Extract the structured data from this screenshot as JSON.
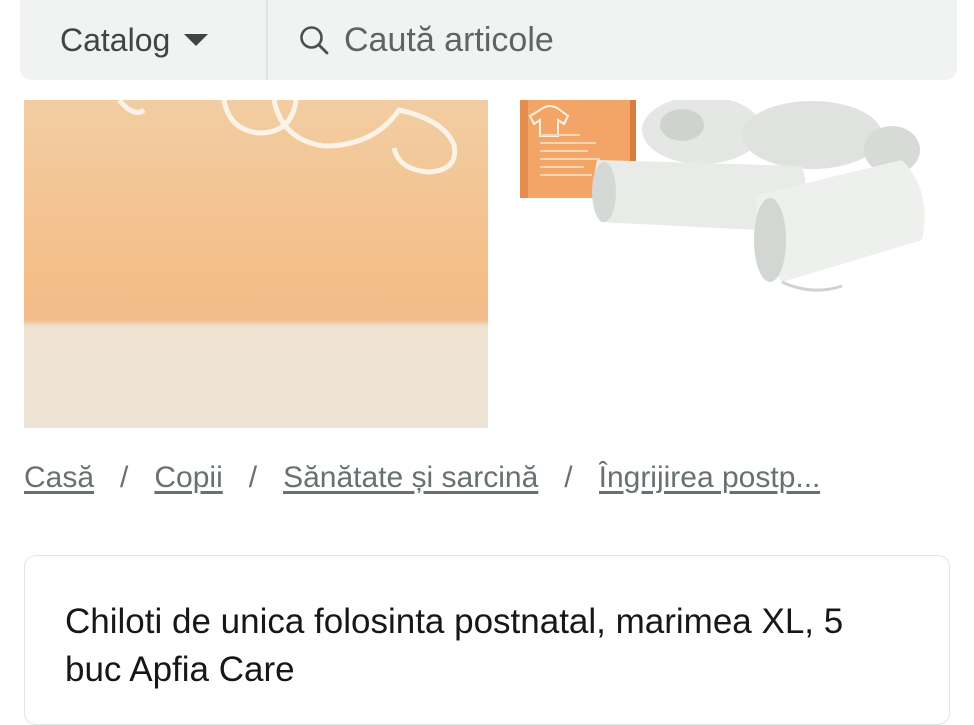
{
  "header": {
    "catalog_label": "Catalog",
    "search_placeholder": "Caută articole"
  },
  "gallery": {
    "images": [
      "product-photo-box",
      "product-photo-packs"
    ]
  },
  "breadcrumb": [
    "Casă",
    "Copii",
    "Sănătate și sarcină",
    "Îngrijirea postp..."
  ],
  "product": {
    "title": "Chiloti de unica folosinta postnatal, marimea XL, 5 buc Apfia Care"
  },
  "colors": {
    "topbar_bg": "#f1f3f3",
    "text_dark": "#171717",
    "text_muted": "#687070",
    "box_orange": "#f4bf8a"
  }
}
